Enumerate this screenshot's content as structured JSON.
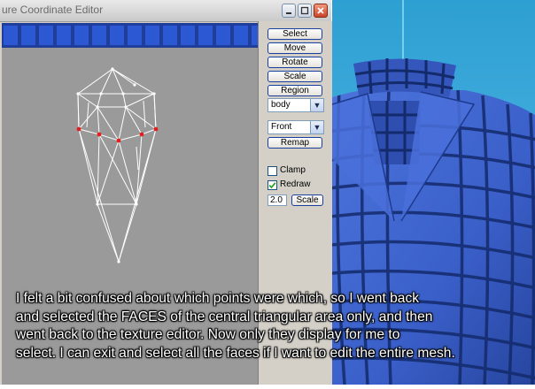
{
  "window": {
    "title": "ure Coordinate Editor",
    "controls": {
      "minimize_icon": "minimize-icon",
      "maximize_icon": "maximize-icon",
      "close_icon": "close-icon"
    }
  },
  "panel": {
    "buttons": {
      "select": "Select",
      "move": "Move",
      "rotate": "Rotate",
      "scale": "Scale",
      "region": "Region"
    },
    "group_select": {
      "value": "body"
    },
    "view_select": {
      "value": "Front"
    },
    "remap_label": "Remap",
    "clamp": {
      "label": "Clamp",
      "checked": false
    },
    "redraw": {
      "label": "Redraw",
      "checked": true
    },
    "scale_value": "2.0",
    "scale_button": "Scale"
  },
  "caption": {
    "line1": "I felt a bit confused about which points were which, so I went back",
    "line2": "and selected the FACES of the central triangular area only, and then",
    "line3": "went back to the texture editor.  Now only they display for me to",
    "line4": "select.  I can exit and select all the faces if I want to edit the entire mesh."
  },
  "colors": {
    "viewport_bg": "#9a9a9a",
    "texture_blue": "#1f3e9c",
    "mesh_line": "#ffffff",
    "selected_vertex": "#e02020",
    "shirt_blue": "#3e63d0",
    "sky_blue": "#3aa8d8",
    "button_border": "#1b3f9c"
  }
}
